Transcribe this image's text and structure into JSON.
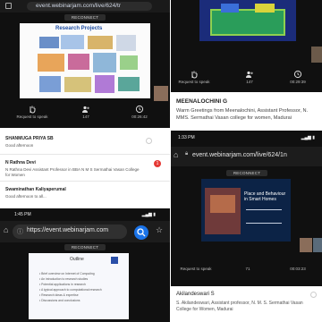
{
  "p1": {
    "url": "event.webinarjam.com/live/624/tr",
    "reconnect": "RECONNECT",
    "slide_title": "Research Projects",
    "controls": {
      "request": "Request to speak",
      "count": "147",
      "time": "00:26:42"
    },
    "chat": [
      {
        "name": "SHANMUGA PRIYA SB",
        "message": "Good afternoon"
      },
      {
        "name": "N Rathna Devi",
        "message": "N Rathna Devi Assistant Professor in BBA N M S Sermathai Vasan College for Women"
      },
      {
        "name": "Swaminathan Kaliyaperumal",
        "message": "Good afternoon to all..."
      }
    ],
    "badge_count": "1"
  },
  "p2": {
    "controls": {
      "request": "Request to speak",
      "count": "147",
      "time": "00:29:39"
    },
    "speaker_name": "MEENALOCHINI G",
    "speaker_message": "Warm Greetings from Meenalochini, Assistant Professor, N. MMS. Sermathai Vasan college for women, Madurai"
  },
  "p3": {
    "status_time": "1:45 PM",
    "url": "https://event.webinarjam.com",
    "reconnect": "RECONNECT",
    "slide_title": "Outline",
    "slide_lines": [
      "Brief overview on Internet of Computing",
      "An introduction to research studies",
      "Potential applications in research",
      "A typical approach to computational research",
      "Research ideas & expertise",
      "Discussions and conclusions"
    ]
  },
  "p4": {
    "status_time": "1:33 PM",
    "url": "event.webinarjam.com/live/624/1n",
    "reconnect": "RECONNECT",
    "slide_title": "Place and Behaviour in Smart Homes",
    "controls": {
      "request": "Request to speak",
      "count": "71",
      "time": "00:03:23"
    },
    "speaker_name": "Akilandeswari S",
    "speaker_message": "S. Akilandeswari, Assistant professor, N. M. S. Sermathai Vasan College for Women, Madurai"
  },
  "colors": {
    "accent_blue": "#1a73e8",
    "badge_red": "#e53935",
    "dark_bg": "#101010"
  }
}
